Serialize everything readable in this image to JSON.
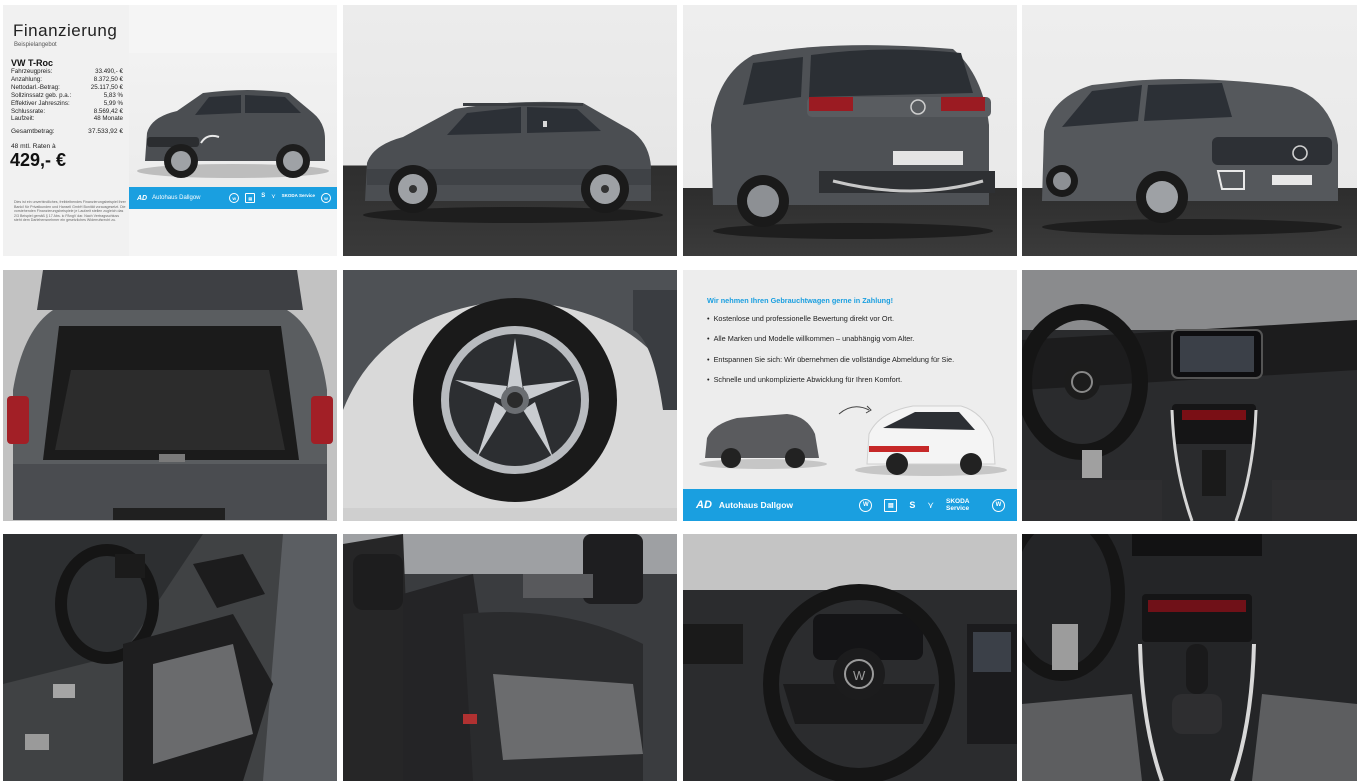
{
  "finance": {
    "title": "Finanzierung",
    "subtitle": "Beispielangebot",
    "model": "VW T-Roc",
    "rows": [
      {
        "label": "Fahrzeugpreis:",
        "value": "33.490,- €"
      },
      {
        "label": "Anzahlung:",
        "value": "8.372,50 €"
      },
      {
        "label": "Nettodarl.-Betrag:",
        "value": "25.117,50 €"
      },
      {
        "label": "Sollzinssatz geb. p.a.:",
        "value": "5,83 %"
      },
      {
        "label": "Effektiver Jahreszins:",
        "value": "5,99 %"
      },
      {
        "label": "Schlussrate:",
        "value": "8.569,42 €"
      },
      {
        "label": "Laufzeit:",
        "value": "48 Monate"
      }
    ],
    "total_label": "Gesamtbetrag:",
    "total_value": "37.533,92 €",
    "rate_label": "48 mtl. Raten à",
    "rate_value": "429,- €",
    "disclaimer": "Dies ist ein unverbindliches, freibleibendes Finanzierungsbeispiel ihrer Bank/i für Privatkunden und Hanseli GmbH Bonität vorausgesetzt. Die vorstehenden Finanzierungsbeispiele je Laufzeit stellen zugleich das 2/3 Beispiel gemäß § 17 Abs. ic PAngV dar. Nach Vertragsschluss steht dem Darlehensnehmer ein gesetzliches Widerrufsrecht zu."
  },
  "dealer": {
    "name": "Autohaus Dallgow",
    "brand_labels": [
      "VW",
      "SEAT",
      "SKODA Service"
    ]
  },
  "tradein": {
    "headline": "Wir nehmen Ihren Gebrauchtwagen gerne in Zahlung!",
    "bullets": [
      "Kostenlose und professionelle Bewertung direkt vor Ort.",
      "Alle Marken und Modelle willkommen – unabhängig vom Alter.",
      "Entspannen Sie sich: Wir übernehmen die vollständige Abmeldung für Sie.",
      "Schnelle und unkomplizierte Abwicklung für Ihren Komfort."
    ]
  },
  "colors": {
    "dealer_blue": "#1a9fe0",
    "car_grey": "#4b4e52"
  },
  "photos": [
    "side-profile",
    "rear-three-quarter",
    "front-three-quarter",
    "trunk-open",
    "wheel-closeup",
    "dashboard-center-console",
    "driver-seat-door-open",
    "rear-seats",
    "steering-wheel",
    "gear-shifter-console"
  ]
}
